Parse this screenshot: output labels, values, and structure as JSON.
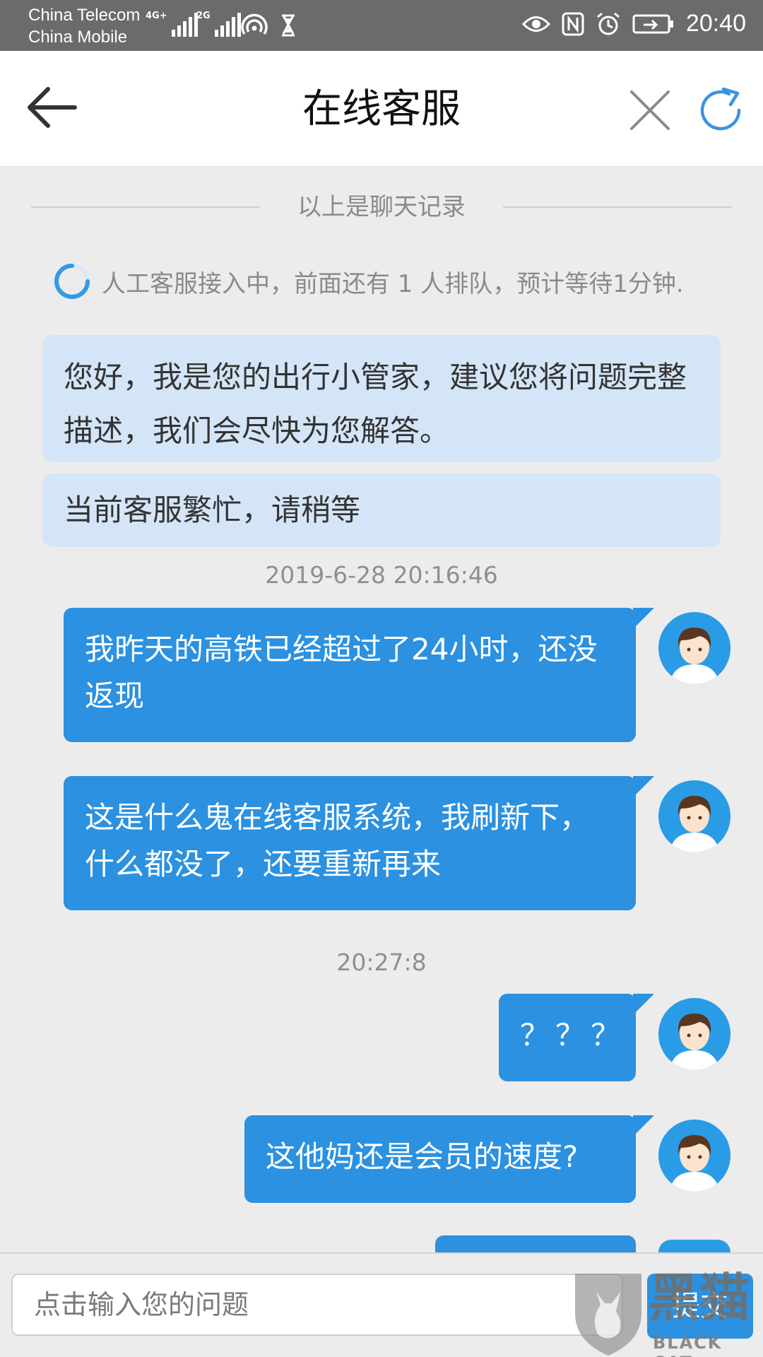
{
  "status_bar": {
    "carrier_1": "China Telecom",
    "carrier_2": "China Mobile",
    "net_1": "4G+",
    "net_2": "2G",
    "time": "20:40"
  },
  "header": {
    "title": "在线客服"
  },
  "chat": {
    "history_divider": "以上是聊天记录",
    "queue_notice": "人工客服接入中，前面还有 1 人排队，预计等待1分钟.",
    "agent_messages": [
      "您好，我是您的出行小管家，建议您将问题完整描述，我们会尽快为您解答。",
      "当前客服繁忙，请稍等"
    ],
    "timestamp_1": "2019-6-28 20:16:46",
    "timestamp_2": "20:27:8",
    "user_messages": [
      "我昨天的高铁已经超过了24小时，还没返现",
      "这是什么鬼在线客服系统，我刷新下，什么都没了，还要重新再来",
      "？？？",
      "这他妈还是会员的速度?"
    ]
  },
  "input": {
    "placeholder": "点击输入您的问题",
    "send_label": "提交"
  },
  "watermark": {
    "cn": "黑猫",
    "en": "BLACK CAT"
  },
  "colors": {
    "status_bar": "#6b6b6b",
    "agent_bubble": "#d4e5f7",
    "user_bubble": "#2b91e0",
    "accent": "#2b91e0"
  }
}
